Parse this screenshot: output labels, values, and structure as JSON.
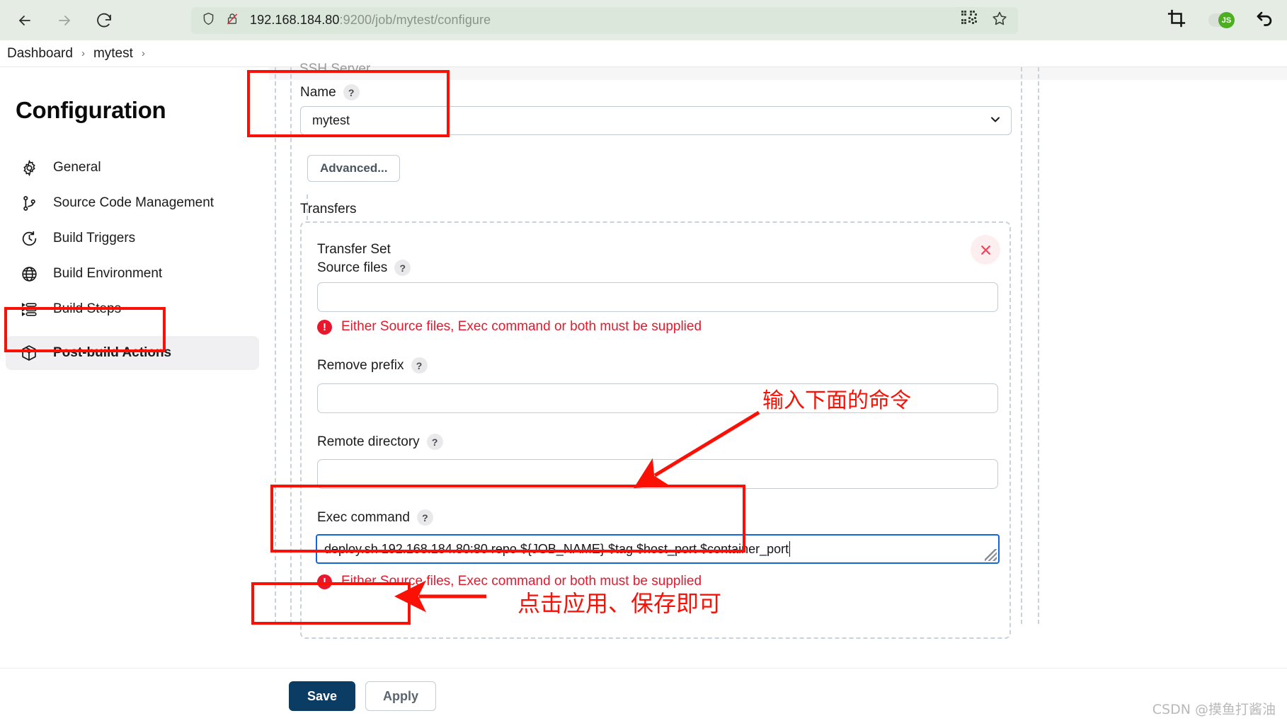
{
  "browser": {
    "back_icon": "arrow-left-icon",
    "forward_icon": "arrow-right-icon",
    "reload_icon": "reload-icon",
    "shield_icon": "shield-icon",
    "insecure_icon": "lock-crossed-icon",
    "url_host": "192.168.184.80",
    "url_path": ":9200/job/mytest/configure",
    "qr_icon": "qr-code-icon",
    "bookmark_icon": "star-icon",
    "crop_icon": "crop-icon",
    "js_toggle_label": "JS",
    "undo_icon": "undo-arrow-icon"
  },
  "breadcrumb": {
    "items": [
      {
        "label": "Dashboard"
      },
      {
        "label": "mytest"
      }
    ],
    "separator": "›"
  },
  "sidebar": {
    "title": "Configuration",
    "items": [
      {
        "label": "General",
        "icon": "gear-icon"
      },
      {
        "label": "Source Code Management",
        "icon": "git-branch-icon"
      },
      {
        "label": "Build Triggers",
        "icon": "clock-icon"
      },
      {
        "label": "Build Environment",
        "icon": "globe-icon"
      },
      {
        "label": "Build Steps",
        "icon": "list-steps-icon"
      },
      {
        "label": "Post-build Actions",
        "icon": "package-icon"
      }
    ],
    "active_index": 5
  },
  "form": {
    "ssh_server_heading": "SSH Server",
    "name_label": "Name",
    "help_glyph": "?",
    "name_value": "mytest",
    "chevron_icon": "chevron-down-icon",
    "advanced_button": "Advanced...",
    "transfers_heading": "Transfers",
    "transfer_set_heading": "Transfer Set",
    "close_icon": "close-icon",
    "source_files_label": "Source files",
    "source_files_value": "",
    "error_source": "Either Source files, Exec command or both must be supplied",
    "error_glyph": "!",
    "remove_prefix_label": "Remove prefix",
    "remove_prefix_value": "",
    "remote_directory_label": "Remote directory",
    "remote_directory_value": "",
    "exec_command_label": "Exec command",
    "exec_command_value": "deploy.sh 192.168.184.80:80 repo ${JOB_NAME} $tag $host_port $container_port",
    "error_exec": "Either Source files, Exec command or both must be supplied",
    "resize_grip_icon": "resize-grip-icon"
  },
  "footer": {
    "save_label": "Save",
    "apply_label": "Apply"
  },
  "annotations": {
    "enter_command": "输入下面的命令",
    "click_apply_save": "点击应用、保存即可",
    "color": "#fb1005"
  },
  "watermark": {
    "text": "CSDN @摸鱼打酱油"
  }
}
